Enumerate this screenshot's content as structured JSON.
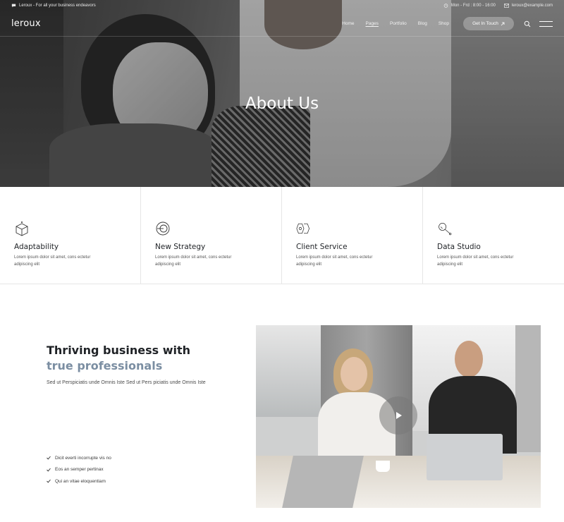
{
  "topbar": {
    "tagline": "Leroux - For all your business endeavors",
    "hours": "Mon - Frd : 8:00 - 16:00",
    "email": "leroux@example.com"
  },
  "nav": {
    "logo": "leroux",
    "links": [
      "Home",
      "Pages",
      "Portfolio",
      "Blog",
      "Shop"
    ],
    "active": "Pages",
    "cta_label": "Get In Touch",
    "cta_icon": "arrow-up-right-icon"
  },
  "hero": {
    "title": "About Us"
  },
  "features": [
    {
      "title": "Adaptability",
      "text": "Lorem ipsum dolor sit amet, cons ectetur adipiscing elit",
      "icon": "box-icon"
    },
    {
      "title": "New Strategy",
      "text": "Lorem ipsum dolor sit amet, cons ectetur adipiscing elit",
      "icon": "target-icon"
    },
    {
      "title": "Client Service",
      "text": "Lorem ipsum dolor sit amet, cons ectetur adipiscing elit",
      "icon": "hexagons-icon"
    },
    {
      "title": "Data Studio",
      "text": "Lorem ipsum dolor sit amet, cons ectetur adipiscing elit",
      "icon": "magnifier-icon"
    }
  ],
  "about": {
    "heading_line1": "Thriving business with",
    "heading_line2": "true professionals",
    "text": "Sed ut Perspiciatis unde Omnis Iste Sed ut Pers piciatis unde Omnis Iste",
    "checklist": [
      "Dicit everti incorrupte vis no",
      "Eos an semper pertinax",
      "Qui an vitae eloquentiam"
    ]
  },
  "colors": {
    "accent": "#7b8ea2",
    "text": "#1f2226",
    "border": "#e6e6e6"
  }
}
